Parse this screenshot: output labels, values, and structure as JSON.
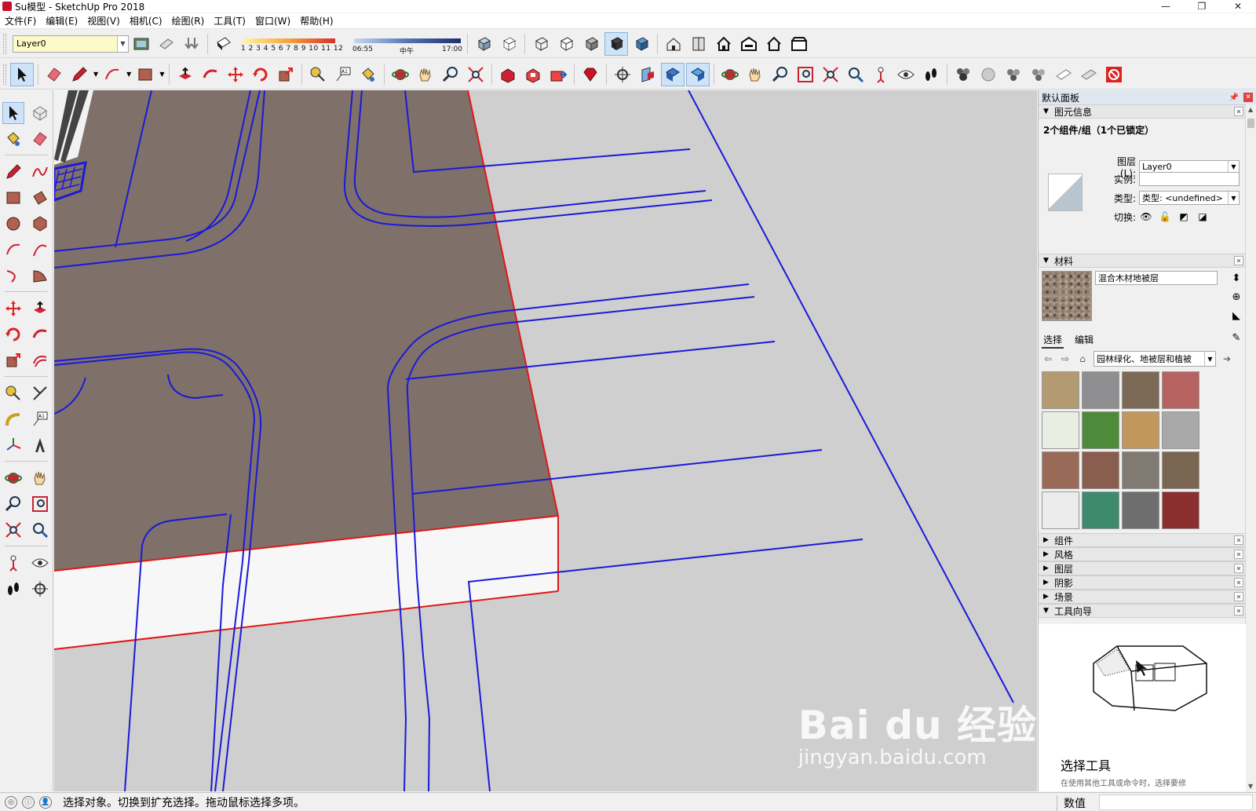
{
  "window": {
    "title": "Su模型 - SketchUp Pro 2018",
    "controls": [
      "—",
      "❐",
      "✕"
    ]
  },
  "menu": [
    "文件(F)",
    "编辑(E)",
    "视图(V)",
    "相机(C)",
    "绘图(R)",
    "工具(T)",
    "窗口(W)",
    "帮助(H)"
  ],
  "toolbar_top": {
    "layer_value": "Layer0",
    "shadow_scale": "1 2 3 4 5 6 7 8 9 10 11 12",
    "time_start": "06:55",
    "time_mid": "中午",
    "time_end": "17:00"
  },
  "panel": {
    "title": "默认面板",
    "entity_info": {
      "section": "图元信息",
      "count_label": "2个组件/组（1个已锁定）",
      "layer_label": "图层(L):",
      "layer_value": "Layer0",
      "instance_label": "实例:",
      "instance_value": "",
      "type_label": "类型:",
      "type_value": "类型: <undefined>",
      "toggle_label": "切换:"
    },
    "materials": {
      "section": "材料",
      "name": "混合木材地被层",
      "tab_select": "选择",
      "tab_edit": "编辑",
      "collection": "园林绿化、地被层和植被",
      "swatches": [
        "#b49a72",
        "#8f8f92",
        "#7d6a56",
        "#b66260",
        "#e9eee3",
        "#4d8a3a",
        "#c2975c",
        "#a8a8a8",
        "#9a6a58",
        "#8a5e4e",
        "#807a72",
        "#7a6552",
        "#ececec",
        "#3d8a6e",
        "#6e6e6e",
        "#8a2e2e"
      ]
    },
    "collapsed_sections": [
      "组件",
      "风格",
      "图层",
      "阴影",
      "场景"
    ],
    "guide": {
      "section": "工具向导",
      "tool_title": "选择工具",
      "tool_desc": "在使用其他工具或命令时，选择要修"
    }
  },
  "watermark": {
    "brand": "Bai du 经验",
    "url": "jingyan.baidu.com"
  },
  "status": {
    "text": "选择对象。切换到扩充选择。拖动鼠标选择多项。",
    "measurements_label": "数值",
    "measurements_value": ""
  },
  "colors": {
    "viewport_bg": "#cfcfcf",
    "slab_top": "#7f7069",
    "road_line": "#1a1ad8",
    "edge_red": "#e01818"
  }
}
